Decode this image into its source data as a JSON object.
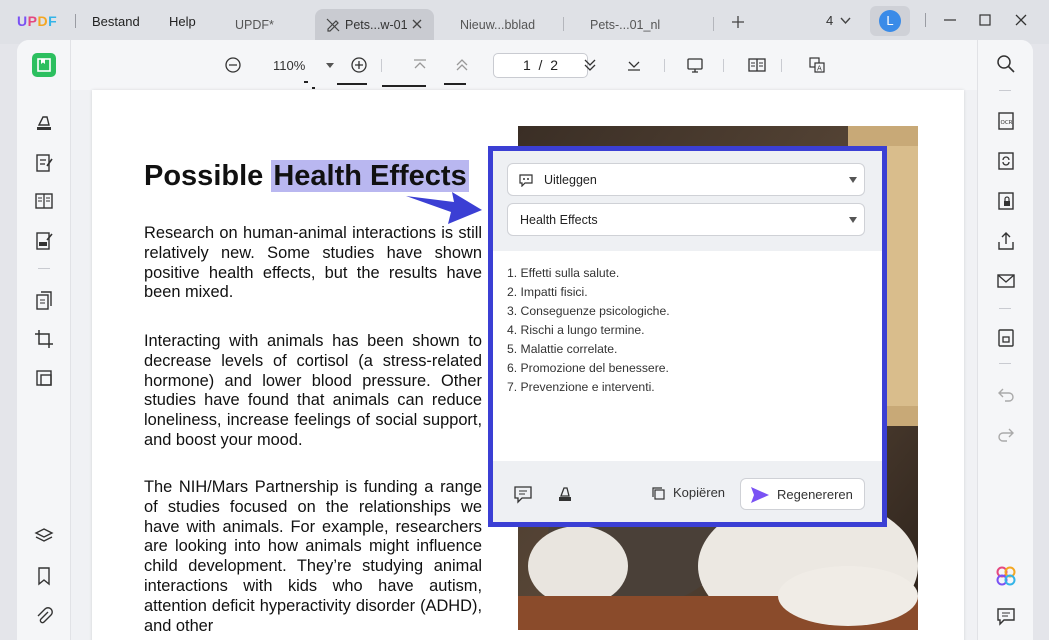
{
  "app": {
    "logo": "UPDF"
  },
  "menu": {
    "file": "Bestand",
    "help": "Help"
  },
  "tabs": [
    {
      "label": "UPDF*"
    },
    {
      "label": "Pets...w-01"
    },
    {
      "label": "Nieuw...bblad"
    },
    {
      "label": "Pets-...01_nl"
    }
  ],
  "titlebar": {
    "page_count": "4",
    "avatar_letter": "L"
  },
  "toolbar": {
    "zoom": "110%",
    "page_current": "1",
    "page_sep": "/",
    "page_total": "2"
  },
  "document": {
    "cut_line": "                       ",
    "heading_plain": "Possible ",
    "heading_highlight": "Health Effects",
    "para1": "Research on human-animal interactions is still relatively new. Some studies have shown positive health effects, but the results have been mixed.",
    "para2": "Interacting with animals has been shown to decrease levels of cortisol (a stress-related hormone) and lower blood pressure. Other studies have found that animals can reduce loneliness, increase feelings of social support, and boost your mood.",
    "para3": "The NIH/Mars Partnership is funding a range of studies focused on the relationships we have with animals. For example, researchers are looking into how animals might influence child development. They’re studying animal interactions with kids who have autism, attention deficit hyperactivity disorder (ADHD), and other"
  },
  "ai_panel": {
    "mode": "Uitleggen",
    "selection": "Health Effects",
    "answer": [
      "1. Effetti sulla salute.",
      "2. Impatti fisici.",
      "3. Conseguenze psicologiche.",
      "4. Rischi a lungo termine.",
      "5. Malattie correlate.",
      "6. Promozione del benessere.",
      "7. Prevenzione e interventi."
    ],
    "copy_label": "Kopiëren",
    "regenerate_label": "Regenereren"
  },
  "colors": {
    "accent": "#3b3fd4",
    "highlight": "#b9b7f0",
    "reader_green": "#2cbf5f",
    "avatar": "#3a8be8"
  }
}
